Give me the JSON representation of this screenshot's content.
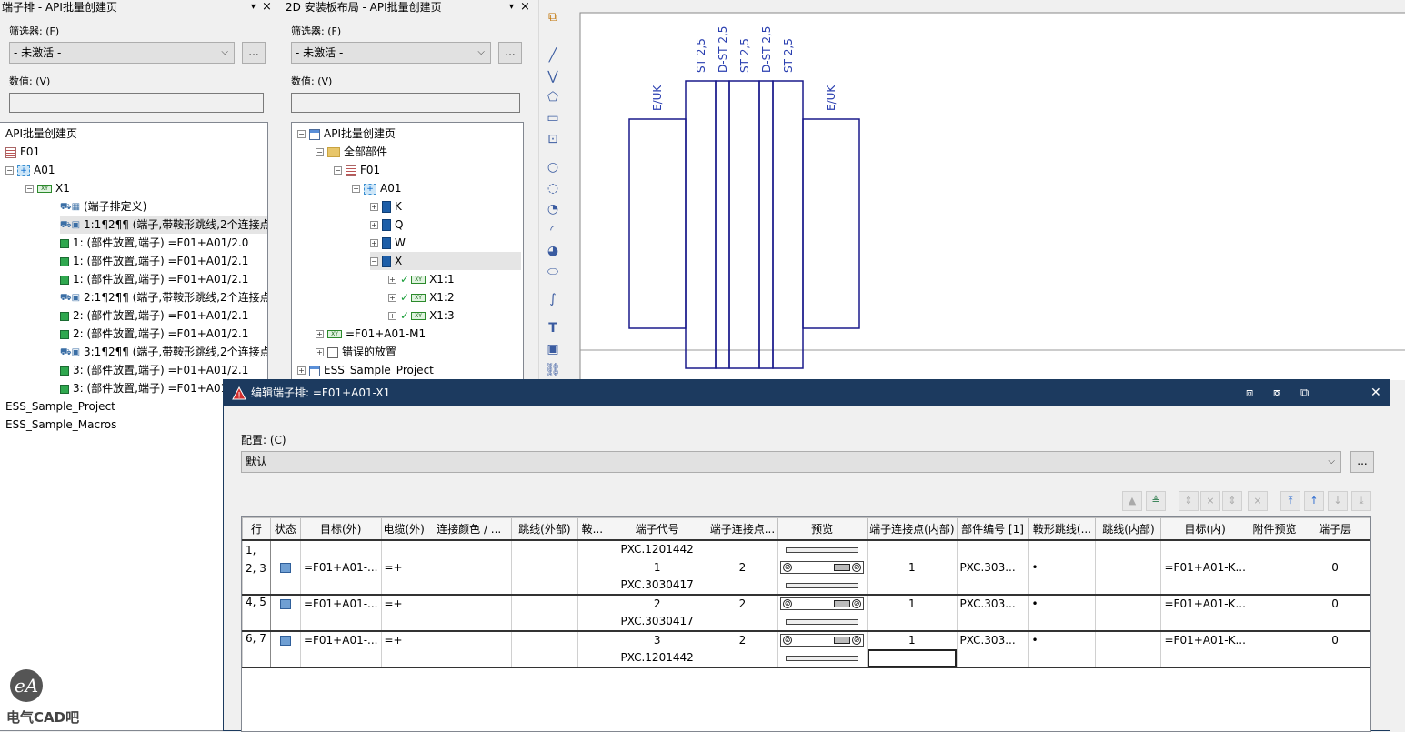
{
  "left_panel": {
    "title": "端子排 - API批量创建页",
    "pin": "▾",
    "close": "×",
    "filter_label": "筛选器: (F)",
    "filter_value": "- 未激活 -",
    "browse_label": "...",
    "value_label": "数值: (V)",
    "tree": [
      "API批量创建页",
      "F01",
      "A01",
      "X1",
      "(端子排定义)",
      "1:1¶2¶¶ (端子,带鞍形跳线,2个连接点",
      "1: (部件放置,端子) =F01+A01/2.0",
      "1: (部件放置,端子) =F01+A01/2.1",
      "1: (部件放置,端子) =F01+A01/2.1",
      "2:1¶2¶¶ (端子,带鞍形跳线,2个连接点",
      "2: (部件放置,端子) =F01+A01/2.1",
      "2: (部件放置,端子) =F01+A01/2.1",
      "3:1¶2¶¶ (端子,带鞍形跳线,2个连接点",
      "3: (部件放置,端子) =F01+A01/2.1",
      "3: (部件放置,端子) =F01+A01",
      "ESS_Sample_Project",
      "ESS_Sample_Macros"
    ]
  },
  "mid_panel": {
    "title": "2D 安装板布局 - API批量创建页",
    "pin": "▾",
    "close": "×",
    "filter_label": "筛选器: (F)",
    "filter_value": "- 未激活 -",
    "browse_label": "...",
    "value_label": "数值: (V)",
    "tree": [
      "API批量创建页",
      "全部部件",
      "F01",
      "A01",
      "K",
      "Q",
      "W",
      "X",
      "X1:1",
      "X1:2",
      "X1:3",
      "=F01+A01-M1",
      "错误的放置",
      "ESS_Sample_Project"
    ]
  },
  "canvas": {
    "labels_top": [
      "ST 2,5",
      "D-ST 2,5",
      "ST 2,5",
      "D-ST 2,5",
      "ST 2,5"
    ],
    "label_left": "E/UK",
    "label_right": "E/UK",
    "line_color": "#1a1a8c"
  },
  "dialog": {
    "title": "编辑端子排: =F01+A01-X1",
    "config_label": "配置: (C)",
    "config_value": "默认",
    "browse_label": "...",
    "close": "✕",
    "columns": [
      "行",
      "状态",
      "目标(外)",
      "电缆(外)",
      "连接颜色 / ...",
      "跳线(外部)",
      "鞍...",
      "端子代号",
      "端子连接点...",
      "预览",
      "端子连接点(内部)",
      "部件编号 [1]",
      "鞍形跳线(...",
      "跳线(内部)",
      "目标(内)",
      "附件预览",
      "端子层"
    ],
    "groups": [
      {
        "row": "1, 2, 3",
        "top": "PXC.1201442",
        "target_out": "=F01+A01-...",
        "cable_out": "=+",
        "code": "1",
        "conn_out": "2",
        "conn_in": "1",
        "part": "PXC.303...",
        "saddle": "•",
        "target_in": "=F01+A01-K...",
        "layer": "0",
        "bottom": "PXC.3030417"
      },
      {
        "row": "4, 5",
        "target_out": "=F01+A01-...",
        "cable_out": "=+",
        "code": "2",
        "conn_out": "2",
        "conn_in": "1",
        "part": "PXC.303...",
        "saddle": "•",
        "target_in": "=F01+A01-K...",
        "layer": "0",
        "bottom": "PXC.3030417"
      },
      {
        "row": "6, 7",
        "target_out": "=F01+A01-...",
        "cable_out": "=+",
        "code": "3",
        "conn_out": "2",
        "conn_in": "1",
        "part": "PXC.303...",
        "saddle": "•",
        "target_in": "=F01+A01-K...",
        "layer": "0",
        "bottom": "PXC.1201442"
      }
    ]
  },
  "watermark": {
    "text": "电气CAD吧"
  }
}
